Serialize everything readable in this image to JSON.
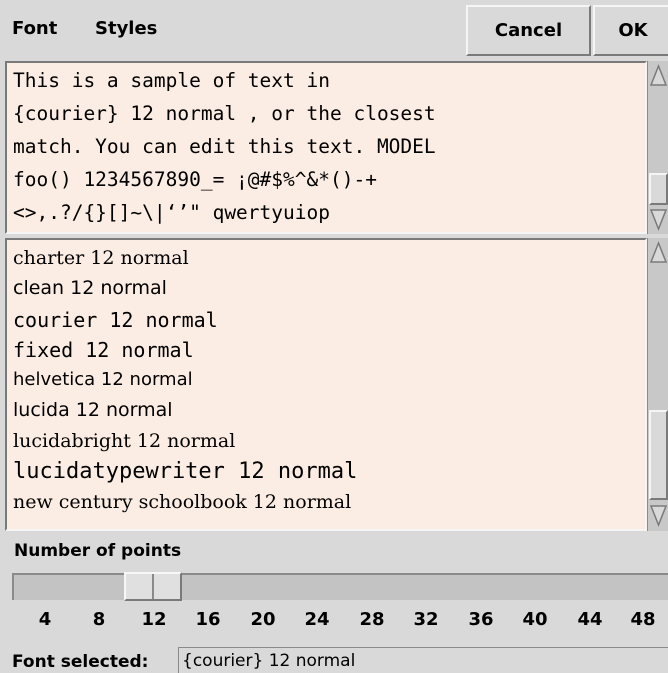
{
  "menubar": {
    "font_label": "Font",
    "styles_label": "Styles"
  },
  "buttons": {
    "cancel_label": "Cancel",
    "ok_label": "OK"
  },
  "sample_text": {
    "lines": [
      "This is a sample of text in",
      "{courier} 12 normal , or the closest",
      "match. You can edit this text. MODEL",
      "foo() 1234567890_= ¡@#$%^&*()-+",
      "<>,.?/{}[]~\\|‘’\" qwertyuiop"
    ]
  },
  "font_list": {
    "items": [
      "charter 12 normal",
      "clean 12 normal",
      "courier 12 normal",
      "fixed 12 normal",
      "helvetica 12 normal",
      "lucida 12 normal",
      "lucidabright 12 normal",
      "lucidatypewriter 12 normal",
      "new century schoolbook 12 normal"
    ]
  },
  "points": {
    "label": "Number of points",
    "ticks": [
      "4",
      "8",
      "12",
      "16",
      "20",
      "24",
      "28",
      "32",
      "36",
      "40",
      "44",
      "48"
    ],
    "selected_value": 12
  },
  "status": {
    "label": "Font selected:",
    "value": "{courier} 12 normal"
  },
  "colors": {
    "background": "#d9d9d9",
    "text_area_bg": "#fbede3"
  },
  "icons": {
    "scroll_up": "triangle-up-icon",
    "scroll_down": "triangle-down-icon"
  }
}
